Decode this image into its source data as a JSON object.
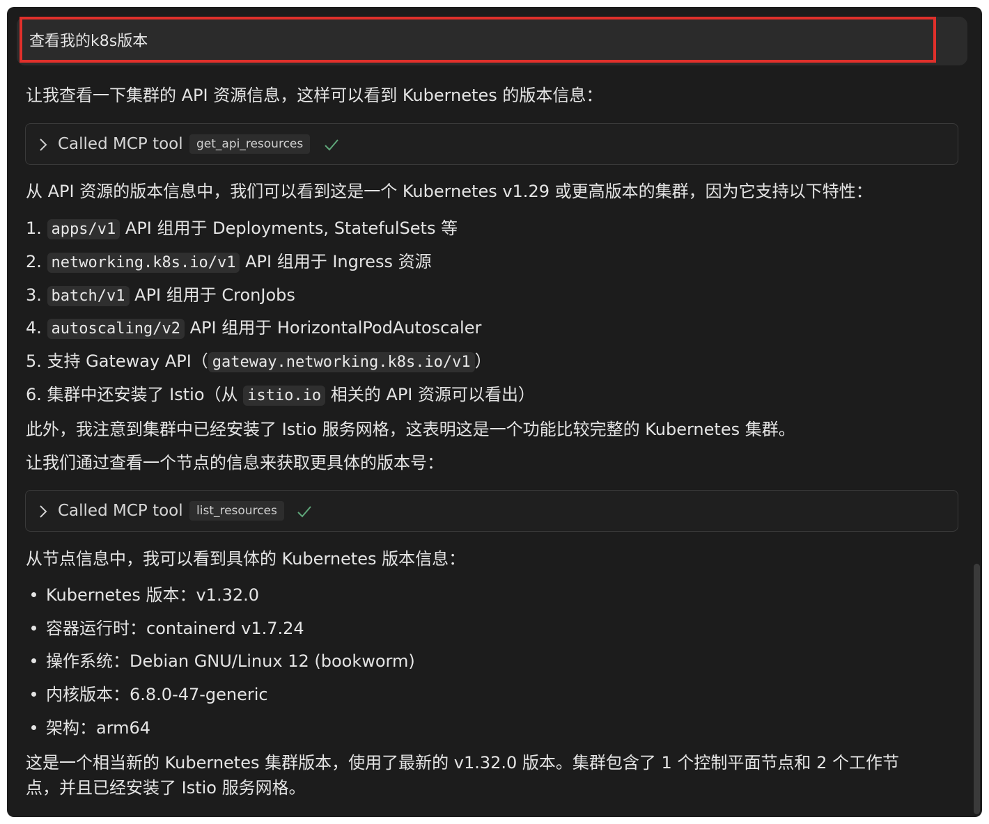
{
  "prompt": {
    "text": "查看我的k8s版本"
  },
  "response": {
    "intro": "让我查看一下集群的 API 资源信息，这样可以看到 Kubernetes 的版本信息：",
    "tool1": {
      "label": "Called MCP tool",
      "name": "get_api_resources"
    },
    "summary1": "从 API 资源的版本信息中，我们可以看到这是一个 Kubernetes v1.29 或更高版本的集群，因为它支持以下特性：",
    "features": [
      {
        "num": "1.",
        "code": "apps/v1",
        "text": "API 组用于 Deployments, StatefulSets 等"
      },
      {
        "num": "2.",
        "code": "networking.k8s.io/v1",
        "text": "API 组用于 Ingress 资源"
      },
      {
        "num": "3.",
        "code": "batch/v1",
        "text": "API 组用于 CronJobs"
      },
      {
        "num": "4.",
        "code": "autoscaling/v2",
        "text": "API 组用于 HorizontalPodAutoscaler"
      },
      {
        "num": "5.",
        "pre": "支持 Gateway API（",
        "code": "gateway.networking.k8s.io/v1",
        "post": "）"
      },
      {
        "num": "6.",
        "pre": "集群中还安装了 Istio（从",
        "code": "istio.io",
        "post": "相关的 API 资源可以看出）"
      }
    ],
    "note": "此外，我注意到集群中已经安装了 Istio 服务网格，这表明这是一个功能比较完整的 Kubernetes 集群。",
    "next": "让我们通过查看一个节点的信息来获取更具体的版本号：",
    "tool2": {
      "label": "Called MCP tool",
      "name": "list_resources"
    },
    "summary2": "从节点信息中，我可以看到具体的 Kubernetes 版本信息：",
    "details": [
      "Kubernetes 版本：v1.32.0",
      "容器运行时：containerd v1.7.24",
      "操作系统：Debian GNU/Linux 12 (bookworm)",
      "内核版本：6.8.0-47-generic",
      "架构：arm64"
    ],
    "conclusion_line1": "这是一个相当新的 Kubernetes 集群版本，使用了最新的 v1.32.0 版本。集群包含了 1 个控制平面节点和 2 个工作节",
    "conclusion_line2": "点，并且已经安装了 Istio 服务网格。"
  },
  "colors": {
    "background": "#1c1c1c",
    "highlight": "#e0302b",
    "check": "#5fa77a"
  }
}
